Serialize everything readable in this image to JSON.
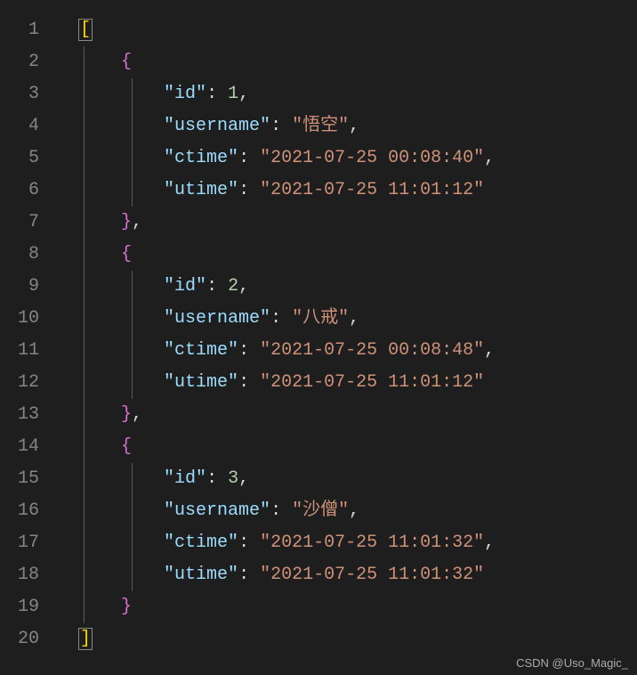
{
  "watermark": "CSDN @Uso_Magic_",
  "lineNumbers": [
    "1",
    "2",
    "3",
    "4",
    "5",
    "6",
    "7",
    "8",
    "9",
    "10",
    "11",
    "12",
    "13",
    "14",
    "15",
    "16",
    "17",
    "18",
    "19",
    "20"
  ],
  "code": {
    "records": [
      {
        "id": 1,
        "username": "悟空",
        "ctime": "2021-07-25 00:08:40",
        "utime": "2021-07-25 11:01:12"
      },
      {
        "id": 2,
        "username": "八戒",
        "ctime": "2021-07-25 00:08:48",
        "utime": "2021-07-25 11:01:12"
      },
      {
        "id": 3,
        "username": "沙僧",
        "ctime": "2021-07-25 11:01:32",
        "utime": "2021-07-25 11:01:32"
      }
    ],
    "keys": {
      "id": "id",
      "username": "username",
      "ctime": "ctime",
      "utime": "utime"
    },
    "brackets": {
      "open_sq": "[",
      "close_sq": "]",
      "open_cb": "{",
      "close_cb": "}"
    },
    "quote": "\"",
    "comma": ",",
    "colon": ":",
    "space": " "
  }
}
